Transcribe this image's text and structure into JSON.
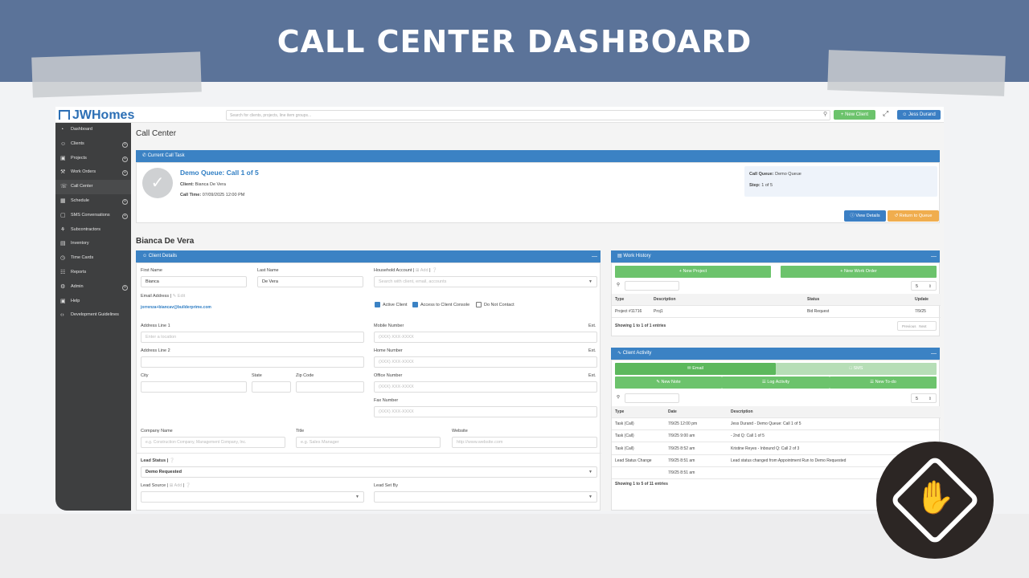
{
  "banner": {
    "title": "CALL CENTER DASHBOARD"
  },
  "header": {
    "logo": "JWHomes",
    "search_placeholder": "Search for clients, projects, line item groups...",
    "new_client": "New Client",
    "user": "Jess Durand"
  },
  "sidebar": {
    "items": [
      {
        "label": "Dashboard",
        "icon": "dashboard-icon",
        "plus": false
      },
      {
        "label": "Clients",
        "icon": "users-icon",
        "plus": true
      },
      {
        "label": "Projects",
        "icon": "briefcase-icon",
        "plus": true
      },
      {
        "label": "Work Orders",
        "icon": "wrench-icon",
        "plus": true
      },
      {
        "label": "Call Center",
        "icon": "headset-icon",
        "plus": false
      },
      {
        "label": "Schedule",
        "icon": "calendar-icon",
        "plus": true
      },
      {
        "label": "SMS Conversations",
        "icon": "chat-icon",
        "plus": true
      },
      {
        "label": "Subcontractors",
        "icon": "handshake-icon",
        "plus": false
      },
      {
        "label": "Inventory",
        "icon": "box-icon",
        "plus": false
      },
      {
        "label": "Time Cards",
        "icon": "clock-icon",
        "plus": false
      },
      {
        "label": "Reports",
        "icon": "chart-icon",
        "plus": false
      },
      {
        "label": "Admin",
        "icon": "gear-icon",
        "plus": true
      },
      {
        "label": "Help",
        "icon": "help-icon",
        "plus": false
      },
      {
        "label": "Development Guidelines",
        "icon": "code-icon",
        "plus": false
      }
    ]
  },
  "main": {
    "title": "Call Center",
    "call_task": {
      "header": "Current Call Task",
      "queue_title": "Demo Queue: Call 1 of 5",
      "client_label": "Client:",
      "client_value": "Bianca De Vera",
      "call_time_label": "Call Time:",
      "call_time_value": "07/09/2025 12:00 PM",
      "call_queue_label": "Call Queue:",
      "call_queue_value": "Demo Queue",
      "step_label": "Step:",
      "step_value": "1 of 5",
      "view_details": "View Details",
      "return_to_queue": "Return to Queue"
    },
    "client_name": "Bianca De Vera",
    "client_details": {
      "header": "Client Details",
      "first_name_label": "First Name",
      "first_name": "Bianca",
      "last_name_label": "Last Name",
      "last_name": "De Vera",
      "household_label": "Household Account",
      "household_add": "Add",
      "household_placeholder": "Search with client, email, accounts",
      "email_label": "Email Address",
      "email_edit": "Edit",
      "email_value": "jorrenza+biancav@builderprime.com",
      "active_client": "Active Client",
      "access_console": "Access to Client Console",
      "do_not_contact": "Do Not Contact",
      "addr1_label": "Address Line 1",
      "addr1_placeholder": "Enter a location",
      "addr2_label": "Address Line 2",
      "mobile_label": "Mobile Number",
      "home_label": "Home Number",
      "office_label": "Office Number",
      "fax_label": "Fax Number",
      "phone_placeholder": "(XXX) XXX-XXXX",
      "ext": "Ext.",
      "city_label": "City",
      "state_label": "State",
      "zip_label": "Zip Code",
      "company_label": "Company Name",
      "company_placeholder": "e.g. Construction Company, Management Company, Inc.",
      "title_label": "Title",
      "title_placeholder": "e.g. Sales Manager",
      "website_label": "Website",
      "website_placeholder": "http://www.website.com",
      "lead_status_label": "Lead Status",
      "lead_status_value": "Demo Requested",
      "lead_source_label": "Lead Source",
      "lead_source_add": "Add",
      "lead_set_by_label": "Lead Set By"
    },
    "work_history": {
      "header": "Work History",
      "new_project": "New Project",
      "new_work_order": "New Work Order",
      "page_size": "5",
      "columns": [
        "Type",
        "Description",
        "Status",
        "Update"
      ],
      "rows": [
        [
          "Project #11716",
          "Proj1",
          "Bid Request",
          "7/9/25"
        ]
      ],
      "footer": "Showing 1 to 1 of 1 entries",
      "prev": "Previous",
      "next": "Next"
    },
    "client_activity": {
      "header": "Client Activity",
      "email": "Email",
      "sms": "SMS",
      "new_note": "New Note",
      "log_activity": "Log Activity",
      "new_todo": "New To-do",
      "page_size": "5",
      "columns": [
        "Type",
        "Date",
        "Description"
      ],
      "rows": [
        [
          "Task (Call)",
          "7/9/25 12:00 pm",
          "Jess Durand - Demo Queue: Call 1 of 5"
        ],
        [
          "Task (Call)",
          "7/9/25 9:00 am",
          "- 2nd Q: Call 1 of 5"
        ],
        [
          "Task (Call)",
          "7/9/25 8:52 am",
          "Kristine Reyes - Inbound Q: Call 2 of 3"
        ],
        [
          "Lead Status Change",
          "7/9/25 8:51 am",
          "Lead status changed from Appointment Run to Demo Requested"
        ],
        [
          "",
          "7/9/25 8:51 am",
          ""
        ]
      ],
      "footer": "Showing 1 to 5 of 11 entries"
    }
  },
  "colors": {
    "banner": "#5b7399",
    "primary": "#3b82c4",
    "green": "#6cc36c",
    "orange": "#f0ad4e",
    "sidebar": "#3e3f40"
  }
}
